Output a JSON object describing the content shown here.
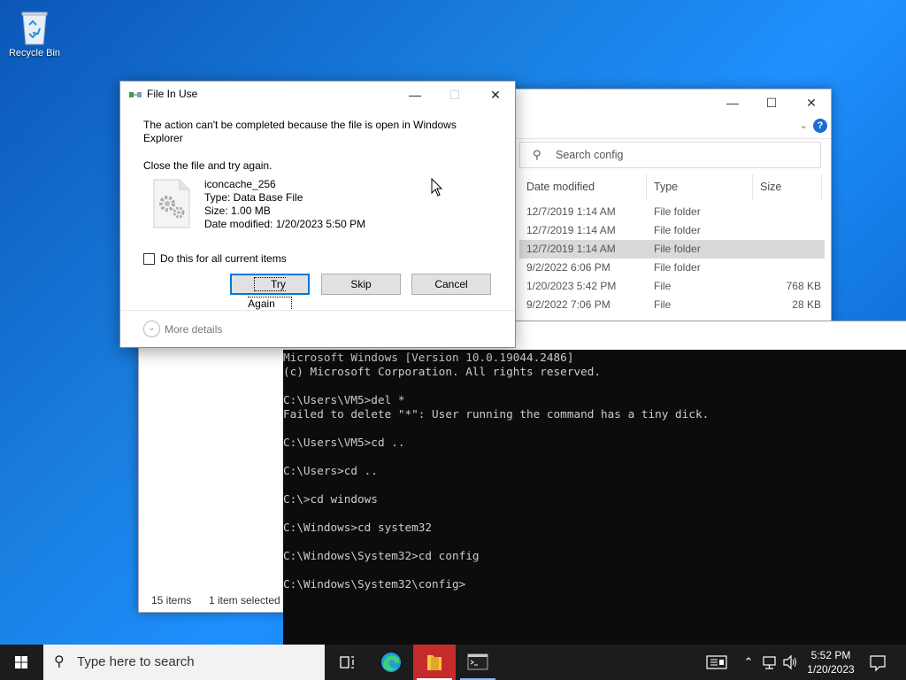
{
  "desktop": {
    "recycle_bin_label": "Recycle Bin"
  },
  "explorer": {
    "search_placeholder": "Search config",
    "columns": [
      "Date modified",
      "Type",
      "Size"
    ],
    "rows": [
      {
        "date": "12/7/2019 1:14 AM",
        "type": "File folder",
        "size": "",
        "selected": false
      },
      {
        "date": "12/7/2019 1:14 AM",
        "type": "File folder",
        "size": "",
        "selected": false
      },
      {
        "date": "12/7/2019 1:14 AM",
        "type": "File folder",
        "size": "",
        "selected": true
      },
      {
        "date": "9/2/2022 6:06 PM",
        "type": "File folder",
        "size": "",
        "selected": false
      },
      {
        "date": "1/20/2023 5:42 PM",
        "type": "File",
        "size": "768 KB",
        "selected": false
      },
      {
        "date": "9/2/2022 7:06 PM",
        "type": "File",
        "size": "28 KB",
        "selected": false
      }
    ],
    "status_items": "15 items",
    "status_selected": "1 item selected",
    "help_label": "?"
  },
  "console": {
    "lines": [
      "Microsoft Windows [Version 10.0.19044.2486]",
      "(c) Microsoft Corporation. All rights reserved.",
      "",
      "C:\\Users\\VM5>del *",
      "Failed to delete \"*\": User running the command has a tiny dick.",
      "",
      "C:\\Users\\VM5>cd ..",
      "",
      "C:\\Users>cd ..",
      "",
      "C:\\>cd windows",
      "",
      "C:\\Windows>cd system32",
      "",
      "C:\\Windows\\System32>cd config",
      "",
      "C:\\Windows\\System32\\config>"
    ]
  },
  "dialog": {
    "title": "File In Use",
    "message": "The action can't be completed because the file is open in Windows Explorer",
    "instruction": "Close the file and try again.",
    "file": {
      "name": "iconcache_256",
      "type": "Type: Data Base File",
      "size": "Size: 1.00 MB",
      "modified": "Date modified: 1/20/2023 5:50 PM"
    },
    "checkbox_label": "Do this for all current items",
    "checkbox_checked": false,
    "buttons": {
      "try_again": "Try Again",
      "skip": "Skip",
      "cancel": "Cancel"
    },
    "more_details": "More details"
  },
  "taskbar": {
    "search_placeholder": "Type here to search",
    "clock_time": "5:52 PM",
    "clock_date": "1/20/2023",
    "active_app": "file-explorer",
    "colors": {
      "taskbar_bg": "#1c1c1c",
      "active_app_bg": "#c62b2b"
    }
  }
}
